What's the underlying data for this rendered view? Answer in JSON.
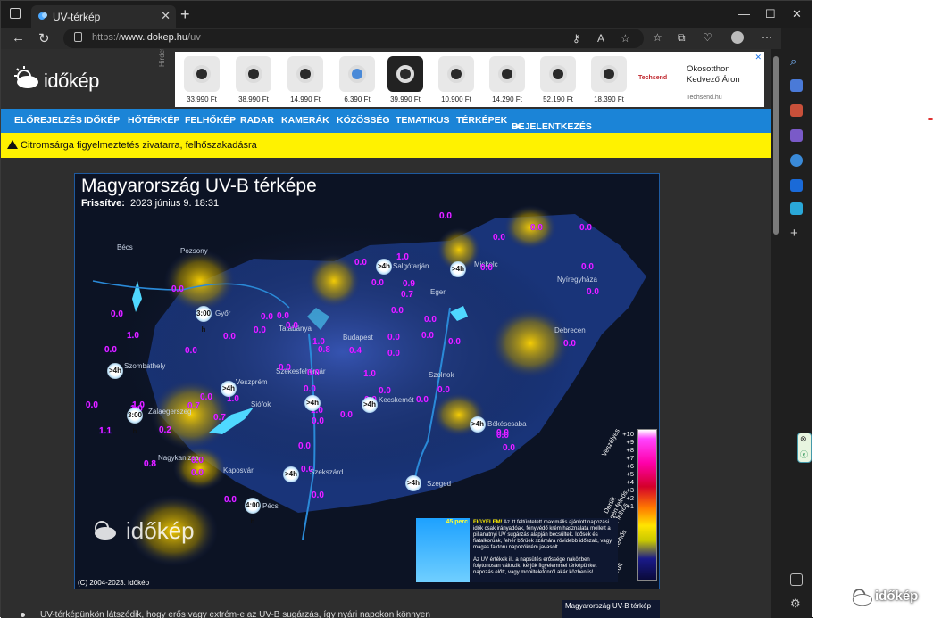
{
  "browser": {
    "tab_title": "UV-térkép",
    "new_tab": "+",
    "url_prefix": "https://",
    "url_host": "www.idokep.hu",
    "url_path": "/uv",
    "win_min": "—",
    "win_max": "☐",
    "win_close": "✕"
  },
  "site": {
    "logo_text": "időkép",
    "ad_label": "Hirdetés",
    "ad_products": [
      {
        "price": "33.990 Ft"
      },
      {
        "price": "38.990 Ft"
      },
      {
        "price": "14.990 Ft"
      },
      {
        "price": "6.390 Ft"
      },
      {
        "price": "39.990 Ft"
      },
      {
        "price": "10.900 Ft"
      },
      {
        "price": "14.290 Ft"
      },
      {
        "price": "52.190 Ft"
      },
      {
        "price": "18.390 Ft"
      }
    ],
    "ad_brand": "Techsend",
    "ad_title": "Okosotthon Kedvező Áron",
    "ad_site": "Techsend.hu",
    "nav": [
      "ELŐREJELZÉS",
      "IDŐKÉP",
      "HŐTÉRKÉP",
      "FELHŐKÉP",
      "RADAR",
      "KAMERÁK",
      "KÖZÖSSÉG",
      "TEMATIKUS",
      "TÉRKÉPEK",
      "BEJELENTKEZÉS"
    ],
    "warning": "Citromsárga figyelmeztetés zivatarra, felhőszakadásra"
  },
  "map": {
    "title": "Magyarország UV-B térképe",
    "updated_label": "Frissítve:",
    "updated_value": "2023 június 9. 18:31",
    "copyright": "(C) 2004-2023. Időkép",
    "watermark": "időkép",
    "cities": [
      {
        "name": "Bécs"
      },
      {
        "name": "Pozsony"
      },
      {
        "name": "Győr"
      },
      {
        "name": "Szombathely"
      },
      {
        "name": "Tatabánya"
      },
      {
        "name": "Budapest"
      },
      {
        "name": "Salgótarján"
      },
      {
        "name": "Miskolc"
      },
      {
        "name": "Nyíregyháza"
      },
      {
        "name": "Eger"
      },
      {
        "name": "Debrecen"
      },
      {
        "name": "Székesfehérvár"
      },
      {
        "name": "Veszprém"
      },
      {
        "name": "Siófok"
      },
      {
        "name": "Zalaegerszeg"
      },
      {
        "name": "Nagykanizsa"
      },
      {
        "name": "Kaposvár"
      },
      {
        "name": "Szekszárd"
      },
      {
        "name": "Pécs"
      },
      {
        "name": "Kecskemét"
      },
      {
        "name": "Szolnok"
      },
      {
        "name": "Békéscsaba"
      },
      {
        "name": "Szeged"
      }
    ],
    "uv_values": [
      "0.0",
      "0.0",
      "0.0",
      "0.0",
      "1.0",
      "0.0",
      "0.0",
      "0.0",
      "0.9",
      "0.7",
      "0.0",
      "0.0",
      "0.0",
      "0.0",
      "0.0",
      "1.0",
      "0.0",
      "1.0",
      "0.8",
      "0.0",
      "0.0",
      "0.7",
      "1.0",
      "0.0",
      "0.0",
      "0.0",
      "0.4",
      "1.0",
      "0.0",
      "0.0",
      "0.0",
      "0.0",
      "0.0",
      "0.2",
      "0.0",
      "0.0",
      "0.0",
      "0.7",
      "0.0",
      "0.0",
      "0.0",
      "0.0",
      "1.0",
      "0.0",
      "0.0",
      "0.0",
      "0.0",
      "0.0",
      "0.0",
      "0.0",
      "1.1",
      "0.8",
      "0.0",
      "0.0",
      "0.0",
      "0.0",
      "1.0",
      "0.0",
      "0.0",
      "0.0",
      "0.0",
      "1.0"
    ],
    "badges": [
      "3:00 h",
      "3:00 h",
      ">4h",
      ">4h",
      ">4h",
      ">4h",
      "4:00 h",
      ">4h",
      ">4h",
      ">4h",
      ">4h",
      ">4h"
    ],
    "legend_values": [
      "+10",
      "+9",
      "+8",
      "+7",
      "+6",
      "+5",
      "+4",
      "+3",
      "+2",
      "+1"
    ],
    "legend_words": [
      "Veszélyes",
      "Derült",
      "Gyengén felhős",
      "Közepesen felhős",
      "Erősen felhős",
      "Borult"
    ],
    "info_badge": "45 perc",
    "info_title": "FIGYELEM!",
    "info_body": "Az itt feltüntetett maximális ajánlott napozási idők csak irányadóak, fényvédő krém használata mellett a pillanatnyi UV sugárzás alapján becsültek. Idősek és fiatalkorúak, fehér bőrüek számára rövidebb időszak, vagy magas faktoru napozókrém javasolt.",
    "info_body2": "Az UV értékek ill. a napsütés erőssége naközben folytonosan változik, kérjük figyelemmel térképünket napozás előtt, vagy mobiltelefonról akár közben is!",
    "thumb_title": "Magyarország UV-B térkép"
  },
  "below": {
    "bullet": "UV-térképünkön látszódik, hogy erős vagy extrém-e az UV-B sugárzás, így nyári napokon könnyen"
  },
  "brand_corner": "időkép"
}
